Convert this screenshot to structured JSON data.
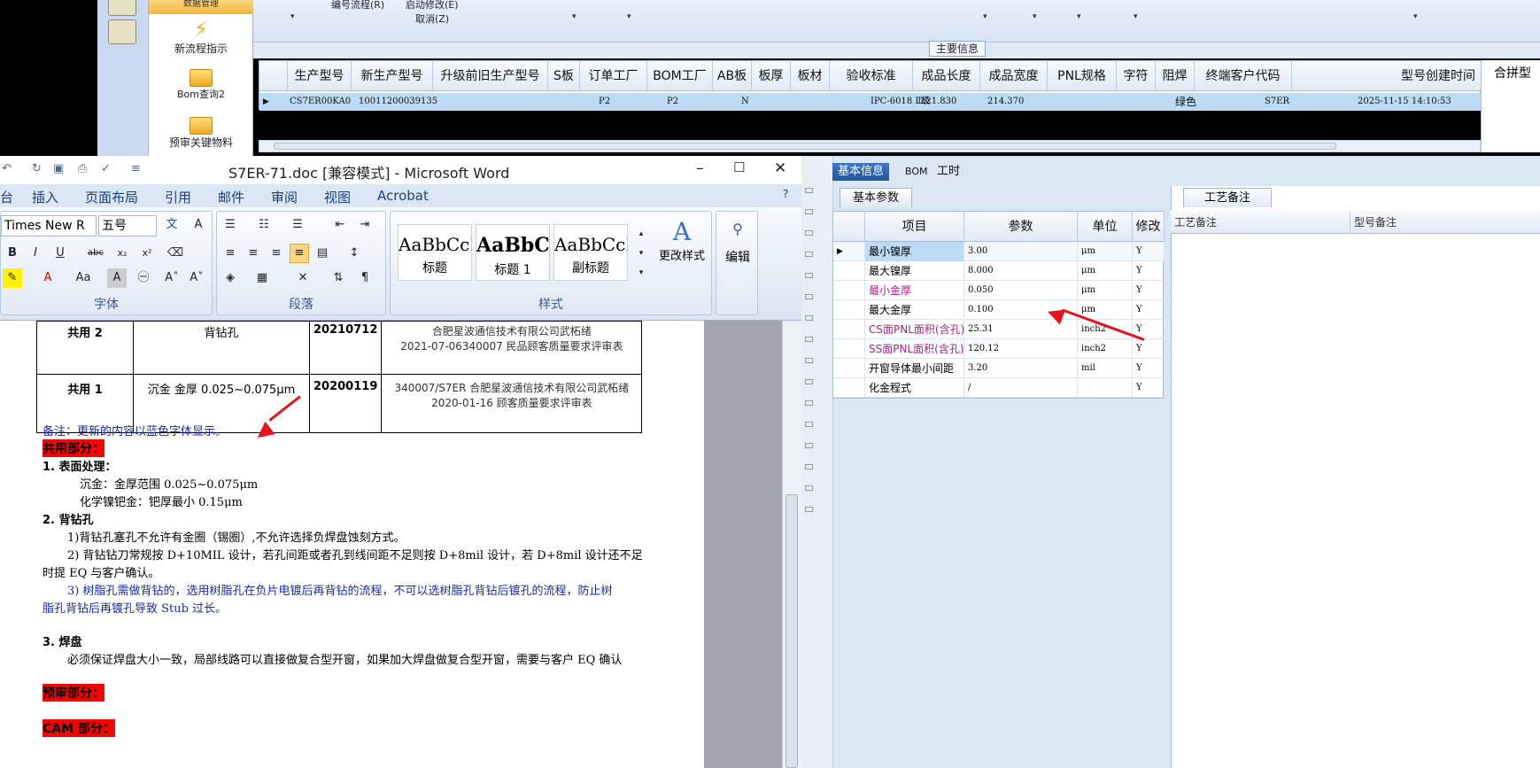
{
  "topbar": {
    "items": [
      "编号流程(R)",
      "启动修改(E)",
      "取消(Z)"
    ]
  },
  "leftnav": {
    "items": [
      "数据管理",
      "新流程指示",
      "Bom查询2",
      "预审关键物料"
    ]
  },
  "main": {
    "section_title": "主要信息",
    "columns": [
      "生产型号",
      "新生产型号",
      "升级前旧生产型号",
      "S板",
      "订单工厂",
      "BOM工厂",
      "AB板",
      "板厚",
      "板材",
      "验收标准",
      "成品长度",
      "成品宽度",
      "PNL规格",
      "字符",
      "阻焊",
      "终端客户代码",
      "型号创建时间"
    ],
    "row": [
      "CS7ER00KA0",
      "10011200039135",
      "",
      "",
      "P2",
      "P2",
      "N",
      "",
      "",
      "IPC-6018 Ⅱ级",
      "221.830",
      "214.370",
      "",
      "",
      "绿色",
      "S7ER",
      "2025-11-15 14:10:53"
    ],
    "right_panel_title": "合拼型"
  },
  "bottom_tabs": [
    "基本信息",
    "BOM",
    "工时"
  ],
  "params": {
    "tab": "基本参数",
    "columns": [
      "项目",
      "参数",
      "单位",
      "修改"
    ],
    "rows": [
      {
        "item": "最小镍厚",
        "value": "3.00",
        "unit": "μm",
        "mod": "Y",
        "color": "#000000"
      },
      {
        "item": "最大镍厚",
        "value": "8.000",
        "unit": "μm",
        "mod": "Y",
        "color": "#000000"
      },
      {
        "item": "最小金厚",
        "value": "0.050",
        "unit": "μm",
        "mod": "Y",
        "color": "#a8238a"
      },
      {
        "item": "最大金厚",
        "value": "0.100",
        "unit": "μm",
        "mod": "Y",
        "color": "#000000"
      },
      {
        "item": "CS面PNL面积(含孔)",
        "value": "25.31",
        "unit": "inch2",
        "mod": "Y",
        "color": "#a8238a"
      },
      {
        "item": "SS面PNL面积(含孔)",
        "value": "120.12",
        "unit": "inch2",
        "mod": "Y",
        "color": "#a8238a"
      },
      {
        "item": "开窗导体最小间距",
        "value": "3.20",
        "unit": "mil",
        "mod": "Y",
        "color": "#000000"
      },
      {
        "item": "化金程式",
        "value": "/",
        "unit": "",
        "mod": "Y",
        "color": "#000000"
      }
    ]
  },
  "craft": {
    "tab": "工艺备注",
    "col1": "工艺备注",
    "col2": "型号备注"
  },
  "word": {
    "title": "S7ER-71.doc [兼容模式] - Microsoft Word",
    "menu": [
      "台",
      "插入",
      "页面布局",
      "引用",
      "邮件",
      "审阅",
      "视图",
      "Acrobat"
    ],
    "font_name": "Times New R",
    "font_size": "五号",
    "groups": {
      "font": "字体",
      "paragraph": "段落",
      "styles": "样式"
    },
    "styles": [
      {
        "preview": "AaBbCcI",
        "name": "标题"
      },
      {
        "preview": "AaBbC",
        "name": "标题 1"
      },
      {
        "preview": "AaBbCcI",
        "name": "副标题"
      }
    ],
    "change_styles": "更改样式",
    "edit": "编辑"
  },
  "doc": {
    "table": [
      {
        "name": "共用 2",
        "desc": "背钻孔",
        "date": "20210712",
        "src1": "合肥星波通信技术有限公司武柘绪",
        "src2": "2021-07-06340007 民品顾客质量要求评审表"
      },
      {
        "name": "共用 1",
        "desc": "沉金 金厚 0.025~0.075μm",
        "date": "20200119",
        "src1": "340007/S7ER 合肥星波通信技术有限公司武柘绪",
        "src2": "2020-01-16 顾客质量要求评审表"
      }
    ],
    "note": "备注：更新的内容以蓝色字体显示。",
    "common": "共用部分：",
    "s1_title": "1.   表面处理：",
    "s1_l1": "沉金：金厚范围 0.025~0.075μm",
    "s1_l2": "化学镍钯金：钯厚最小 0.15μm",
    "s2_title": "2.   背钻孔",
    "s2_l1": "1)背钻孔塞孔不允许有金圈（锡圈）,不允许选择负焊盘蚀刻方式。",
    "s2_l2a": "2)  背钻钻刀常规按 D+10MIL 设计，若孔间距或者孔到线间距不足则按 D+8mil 设计，若 D+8mil 设计还不足",
    "s2_l2b": "时提 EQ 与客户确认。",
    "s2_l3a": "3)  树脂孔需做背钻的，选用树脂孔在负片电镀后再背钻的流程，不可以选树脂孔背钻后镀孔的流程，防止树",
    "s2_l3b": "脂孔背钻后再镀孔导致 Stub 过长。",
    "s3_title": "3.   焊盘",
    "s3_l1": "必须保证焊盘大小一致，局部线路可以直接做复合型开窗，如果加大焊盘做复合型开窗，需要与客户 EQ 确认",
    "pre": "预审部分：",
    "cam": "CAM 部分："
  }
}
